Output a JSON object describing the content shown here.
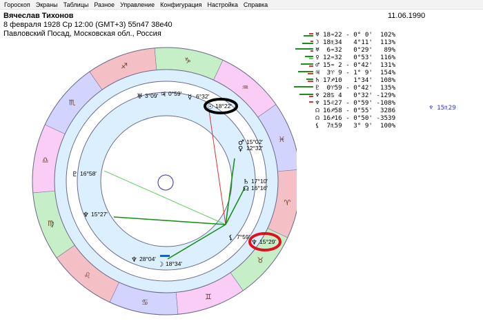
{
  "menu": [
    "Гороскоп",
    "Экраны",
    "Таблицы",
    "Разное",
    "Управление",
    "Конфигурация",
    "Настройка",
    "Справка"
  ],
  "header": {
    "name": "Вячеслав Тихонов",
    "line2": "8 февраля 1928  Ср  12:00 (GMT+3) 55n47  38e40",
    "line3": "Павловский Посад, Московская обл., Россия",
    "transit_date": "11.06.1990"
  },
  "colors": {
    "fire": "#f4c0c6",
    "earth": "#c7efc7",
    "air": "#f9cdf5",
    "water": "#d3d3ff",
    "aspect_red": "#e03030",
    "aspect_green": "#189018",
    "aspect_lightgreen": "#60d060",
    "highlight_black": "#000000",
    "highlight_red": "#e01020"
  },
  "zodiac": [
    {
      "sign": "aries",
      "glyph": "♈"
    },
    {
      "sign": "taurus",
      "glyph": "♉"
    },
    {
      "sign": "gemini",
      "glyph": "♊"
    },
    {
      "sign": "cancer",
      "glyph": "♋"
    },
    {
      "sign": "leo",
      "glyph": "♌"
    },
    {
      "sign": "virgo",
      "glyph": "♍"
    },
    {
      "sign": "libra",
      "glyph": "♎"
    },
    {
      "sign": "scorpio",
      "glyph": "♏"
    },
    {
      "sign": "sagittarius",
      "glyph": "♐"
    },
    {
      "sign": "capricorn",
      "glyph": "♑"
    },
    {
      "sign": "aquarius",
      "glyph": "♒"
    },
    {
      "sign": "pisces",
      "glyph": "♓"
    }
  ],
  "chart_planets": [
    {
      "name": "uranus",
      "glyph": "♅",
      "label": "3°09'"
    },
    {
      "name": "jupiter",
      "glyph": "♃",
      "label": "0°59'"
    },
    {
      "name": "mercury",
      "glyph": "☿",
      "label": "6°32'"
    },
    {
      "name": "sun",
      "glyph": "☉",
      "label": "18°22'",
      "highlight": "black"
    },
    {
      "name": "mars",
      "glyph": "♂",
      "label": "15°02'"
    },
    {
      "name": "venus",
      "glyph": "♀",
      "label": "12°32'"
    },
    {
      "name": "saturn",
      "glyph": "♄",
      "label": "17°10'"
    },
    {
      "name": "node",
      "glyph": "☊",
      "label": "16°16'"
    },
    {
      "name": "pluto",
      "glyph": "♇",
      "label": "16°58'",
      "retro": true
    },
    {
      "name": "neptune",
      "glyph": "♆",
      "label": "15°27'",
      "retro": true
    },
    {
      "name": "lilith",
      "glyph": "⚸",
      "label": "7°59'"
    },
    {
      "name": "transit-neptune",
      "glyph": "♆",
      "label": "15°29'",
      "retro": true,
      "highlight": "red"
    },
    {
      "name": "neptune-2",
      "glyph": "♆",
      "label": "28°04'",
      "retro": true
    },
    {
      "name": "moon",
      "glyph": "☽",
      "label": "18°34'"
    }
  ],
  "planet_table": [
    {
      "glyph": "♅",
      "text": "18♒22 - 0° 0'  102%",
      "bars": [
        [
          "#e03030",
          6
        ],
        [
          "#189018",
          14
        ]
      ]
    },
    {
      "glyph": "☽",
      "text": "18♏34   4°11'  113%",
      "bars": [
        [
          "#e03030",
          4
        ],
        [
          "#189018",
          16
        ]
      ]
    },
    {
      "glyph": "♅",
      "text": " 6♒32   0°29'   89%",
      "bars": [
        [
          "#189018",
          26
        ],
        [
          "#e03030",
          4
        ]
      ]
    },
    {
      "glyph": "♀",
      "text": "12♒32   0°53'  116%",
      "bars": [
        [
          "#189018",
          12
        ],
        [
          "#60d060",
          6
        ]
      ]
    },
    {
      "glyph": "♂",
      "text": "15♒ 2 - 0°42'  131%",
      "bars": [
        [
          "#189018",
          18
        ],
        [
          "#e03030",
          6
        ]
      ]
    },
    {
      "glyph": "♃",
      "text": " 3♈ 9 - 1° 9'  154%",
      "bars": [
        [
          "#189018",
          22
        ],
        [
          "#e03030",
          8
        ]
      ]
    },
    {
      "glyph": "♄",
      "text": "17♐10   1°34'  108%",
      "bars": [
        [
          "#189018",
          10
        ],
        [
          "#e03030",
          8
        ]
      ]
    },
    {
      "glyph": "♇",
      "text": " 0♈59 - 0°42'  135%",
      "bars": [
        [
          "#189018",
          28
        ]
      ]
    },
    {
      "glyph": "♆",
      "text": "28♋ 4   0°32' -129%",
      "bars": [
        [
          "#189018",
          20
        ],
        [
          "#e03030",
          6
        ]
      ]
    },
    {
      "glyph": "♆",
      "text": "15♌27 - 0°59' -108%",
      "bars": [
        [
          "#e03030",
          6
        ]
      ]
    },
    {
      "glyph": "☊",
      "text": "16♐58 - 0°55'  3286",
      "bars": []
    },
    {
      "glyph": "☊",
      "text": "16♐16 - 0°50' -3539",
      "bars": []
    },
    {
      "glyph": "⚸",
      "text": " 7♏59   3° 9'  100%",
      "bars": []
    }
  ],
  "table_extra": "♆ 15♏29"
}
